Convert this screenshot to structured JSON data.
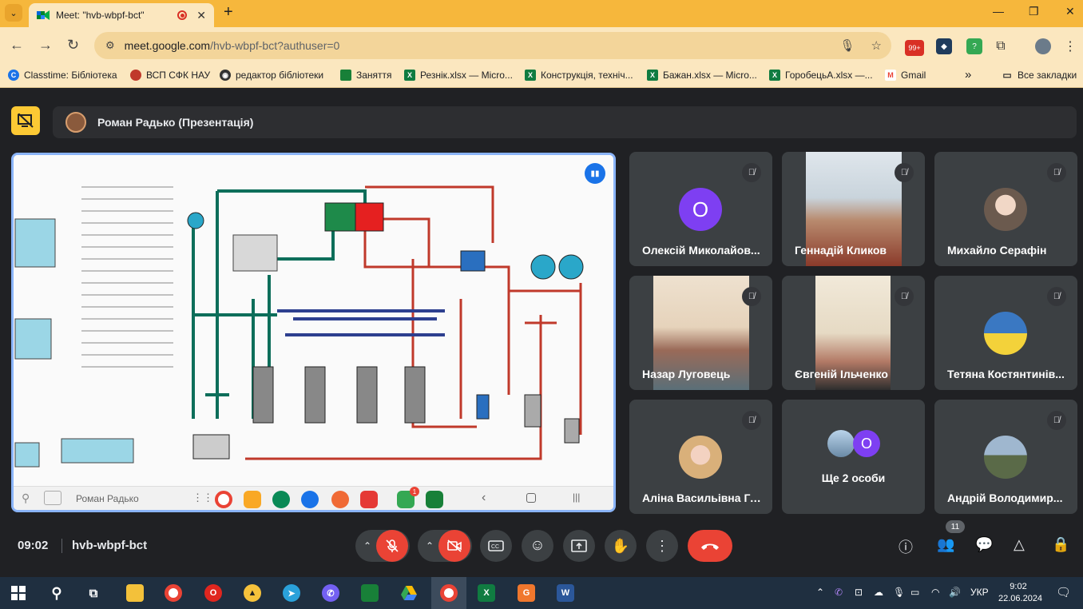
{
  "browser": {
    "tab_title": "Meet: \"hvb-wbpf-bct\"",
    "url_host": "meet.google.com",
    "url_path": "/hvb-wbpf-bct?authuser=0",
    "ext_badge_1": "99+",
    "ext_badge_2": "?",
    "bookmarks": [
      {
        "label": "Classtime: Бібліотека",
        "icon": "classtime-icon",
        "color": "#1a73e8"
      },
      {
        "label": "ВСП СФК НАУ",
        "icon": "crest-icon",
        "color": "#c0392b"
      },
      {
        "label": "редактор бібліотеки",
        "icon": "globe-icon",
        "color": "#333333"
      },
      {
        "label": "Заняття",
        "icon": "classroom-icon",
        "color": "#188038"
      },
      {
        "label": "Резнік.xlsx — Micro...",
        "icon": "excel-icon",
        "color": "#107c41"
      },
      {
        "label": "Конструкція, техніч...",
        "icon": "excel-icon",
        "color": "#107c41"
      },
      {
        "label": "Бажан.xlsx — Micro...",
        "icon": "excel-icon",
        "color": "#107c41"
      },
      {
        "label": "ГоробецьА.xlsx —...",
        "icon": "excel-icon",
        "color": "#107c41"
      },
      {
        "label": "Gmail",
        "icon": "gmail-icon",
        "color": "#ea4335"
      }
    ],
    "more_bookmarks": "»",
    "all_bookmarks": "Все закладки"
  },
  "meet": {
    "presenter_label": "Роман Радько (Презентація)",
    "shared_screen_name": "Роман Радько",
    "dock_badge": "1",
    "participants": [
      {
        "name": "Олексій Миколайов...",
        "type": "letter",
        "letter": "О",
        "color": "#7e3ff2"
      },
      {
        "name": "Геннадій Кликов",
        "type": "video"
      },
      {
        "name": "Михайло Серафін",
        "type": "photo"
      },
      {
        "name": "Назар Луговець",
        "type": "video"
      },
      {
        "name": "Євгеній Ільченко",
        "type": "video"
      },
      {
        "name": "Тетяна Костянтинів...",
        "type": "photo"
      },
      {
        "name": "Аліна Васильівна Го...",
        "type": "photo"
      },
      {
        "name": "Ще 2 особи",
        "type": "more",
        "letter": "О"
      },
      {
        "name": "Андрій Володимир...",
        "type": "photo"
      }
    ],
    "time": "09:02",
    "code": "hvb-wbpf-bct",
    "people_count": "11"
  },
  "taskbar": {
    "lang": "УКР",
    "time": "9:02",
    "date": "22.06.2024"
  },
  "colors": {
    "accent": "#8ab4f8",
    "end_call": "#ea4335",
    "chrome_bg": "#fbe7bf"
  }
}
